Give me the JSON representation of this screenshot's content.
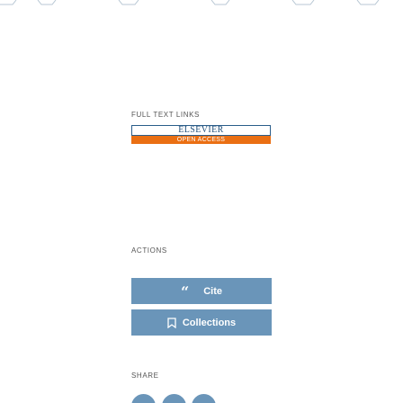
{
  "sections": {
    "links_label": "FULL TEXT LINKS",
    "actions_label": "ACTIONS",
    "share_label": "SHARE"
  },
  "full_text": {
    "publisher_name": "ELSEVIER",
    "access_label": "OPEN ACCESS"
  },
  "actions": {
    "cite_label": "Cite",
    "collections_label": "Collections"
  },
  "icons": {
    "cite": "quote-icon",
    "collections": "bookmark-icon",
    "share": [
      "share-icon",
      "share-icon",
      "share-icon"
    ]
  },
  "colors": {
    "accent": "#6a95b9",
    "publisher_blue": "#1f4e79",
    "publisher_orange": "#ea6f13"
  }
}
